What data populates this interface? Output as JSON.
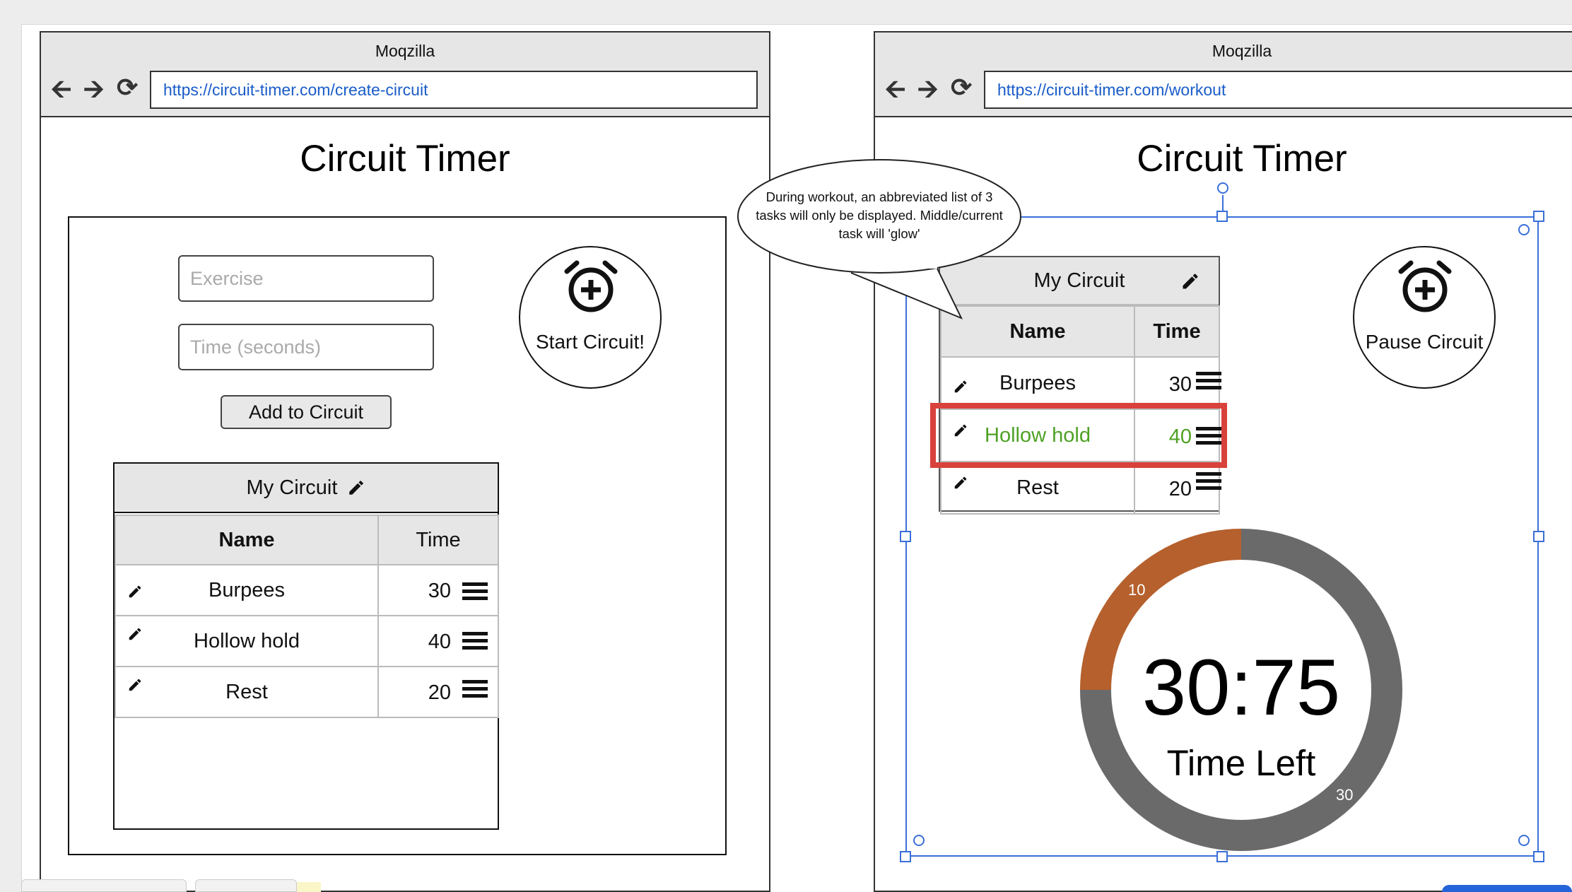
{
  "colors": {
    "accent": "#3a6fd8",
    "highlight": "#d9413b",
    "active_task": "#4ea125",
    "elapsed": "#b5602d",
    "remaining": "#6a6a6a"
  },
  "left": {
    "window_title": "Moqzilla",
    "url": "https://circuit-timer.com/create-circuit",
    "app_title": "Circuit Timer",
    "exercise_placeholder": "Exercise",
    "time_placeholder": "Time (seconds)",
    "add_button": "Add to Circuit",
    "start_button": "Start Circuit!",
    "table": {
      "title": "My Circuit",
      "col_name": "Name",
      "col_time": "Time",
      "rows": [
        {
          "name": "Burpees",
          "time": "30"
        },
        {
          "name": "Hollow hold",
          "time": "40"
        },
        {
          "name": "Rest",
          "time": "20"
        }
      ]
    }
  },
  "right": {
    "window_title": "Moqzilla",
    "url": "https://circuit-timer.com/workout",
    "app_title": "Circuit Timer",
    "pause_button": "Pause Circuit",
    "table": {
      "title": "My Circuit",
      "col_name": "Name",
      "col_time": "Time",
      "rows": [
        {
          "name": "Burpees",
          "time": "30"
        },
        {
          "name": "Hollow hold",
          "time": "40",
          "active": true
        },
        {
          "name": "Rest",
          "time": "20"
        }
      ]
    },
    "timer": {
      "value": "30:75",
      "label": "Time Left",
      "elapsed_label": "10",
      "remaining_label": "30",
      "elapsed_fraction": 0.25
    }
  },
  "callout": {
    "text": "During workout, an abbreviated list of 3 tasks will only be displayed. Middle/current task will 'glow'"
  },
  "icons": [
    "back-arrow-icon",
    "forward-arrow-icon",
    "reload-icon",
    "alarm-add-icon",
    "pencil-icon",
    "drag-handle-icon"
  ]
}
